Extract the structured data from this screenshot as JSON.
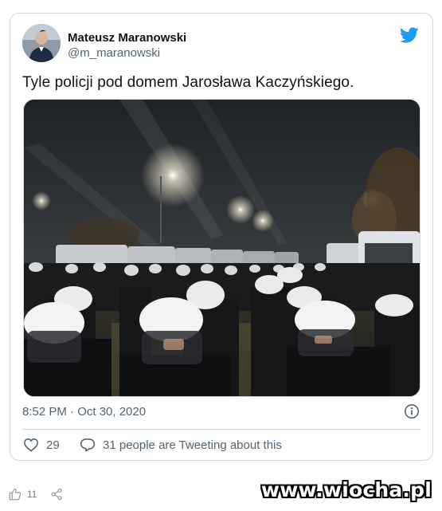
{
  "tweet": {
    "author_name": "Mateusz Maranowski",
    "author_handle": "@m_maranowski",
    "text": "Tyle policji pod domem Jarosława Kaczyńskiego.",
    "timestamp": "8:52 PM · Oct 30, 2020",
    "like_count": "29",
    "tweeting_about": "31 people are Tweeting about this",
    "icons": [
      "twitter-bird-icon",
      "info-icon",
      "heart-icon",
      "reply-bubble-icon"
    ],
    "accent_color": "#1d9bf0"
  },
  "footer": {
    "like_count": "11",
    "icons": [
      "thumbs-up-icon",
      "share-icon"
    ]
  },
  "watermark": {
    "text": "www.wiocha.pl"
  }
}
